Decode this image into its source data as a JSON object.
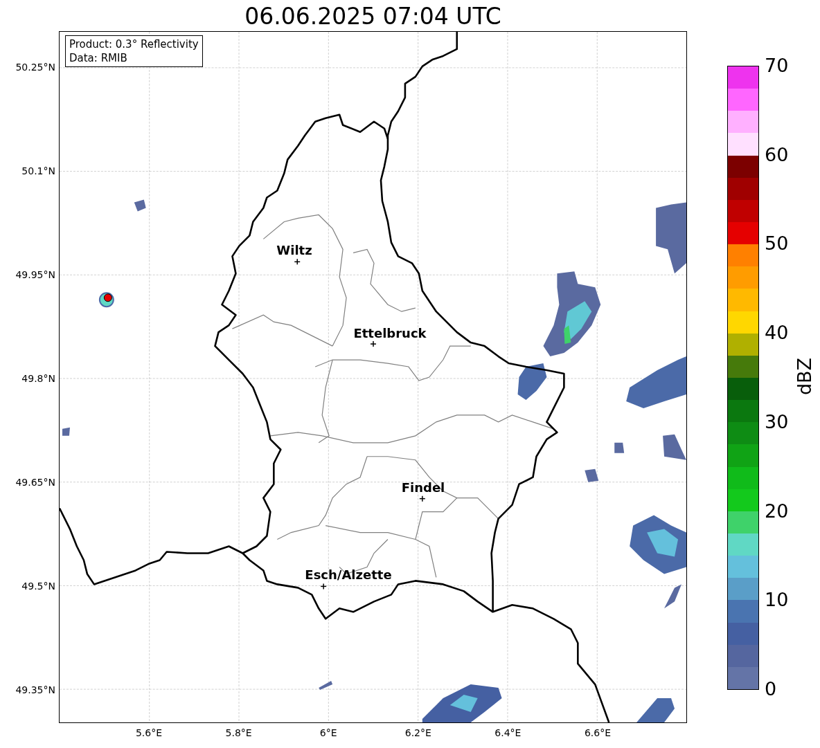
{
  "title": "06.06.2025 07:04 UTC",
  "info_box": [
    "Product: 0.3° Reflectivity",
    "Data: RMIB"
  ],
  "lat_ticks": [
    "50.25°N",
    "50.1°N",
    "49.95°N",
    "49.8°N",
    "49.65°N",
    "49.5°N",
    "49.35°N"
  ],
  "lon_ticks": [
    "5.6°E",
    "5.8°E",
    "6°E",
    "6.2°E",
    "6.4°E",
    "6.6°E"
  ],
  "cities": [
    {
      "name": "Wiltz"
    },
    {
      "name": "Ettelbruck"
    },
    {
      "name": "Findel"
    },
    {
      "name": "Esch/Alzette"
    }
  ],
  "colorbar": {
    "label": "dBZ",
    "ticks": [
      "70",
      "60",
      "50",
      "40",
      "30",
      "20",
      "10",
      "0"
    ],
    "bands": [
      {
        "color": "#6474a7"
      },
      {
        "color": "#55669f"
      },
      {
        "color": "#4560a2"
      },
      {
        "color": "#4a74b0"
      },
      {
        "color": "#5a9ec8"
      },
      {
        "color": "#64c0dc"
      },
      {
        "color": "#60d8c4"
      },
      {
        "color": "#3fd26a"
      },
      {
        "color": "#13c91c"
      },
      {
        "color": "#10bb1a"
      },
      {
        "color": "#10a315"
      },
      {
        "color": "#0e8c14"
      },
      {
        "color": "#0b780f"
      },
      {
        "color": "#085e0b"
      },
      {
        "color": "#467a0b"
      },
      {
        "color": "#b0b000"
      },
      {
        "color": "#ffd700"
      },
      {
        "color": "#ffb900"
      },
      {
        "color": "#ff9c00"
      },
      {
        "color": "#ff8000"
      },
      {
        "color": "#e50000"
      },
      {
        "color": "#c00000"
      },
      {
        "color": "#a00000"
      },
      {
        "color": "#7c0000"
      },
      {
        "color": "#ffe0ff"
      },
      {
        "color": "#ffb0ff"
      },
      {
        "color": "#ff66ff"
      },
      {
        "color": "#ee33ee"
      }
    ]
  }
}
